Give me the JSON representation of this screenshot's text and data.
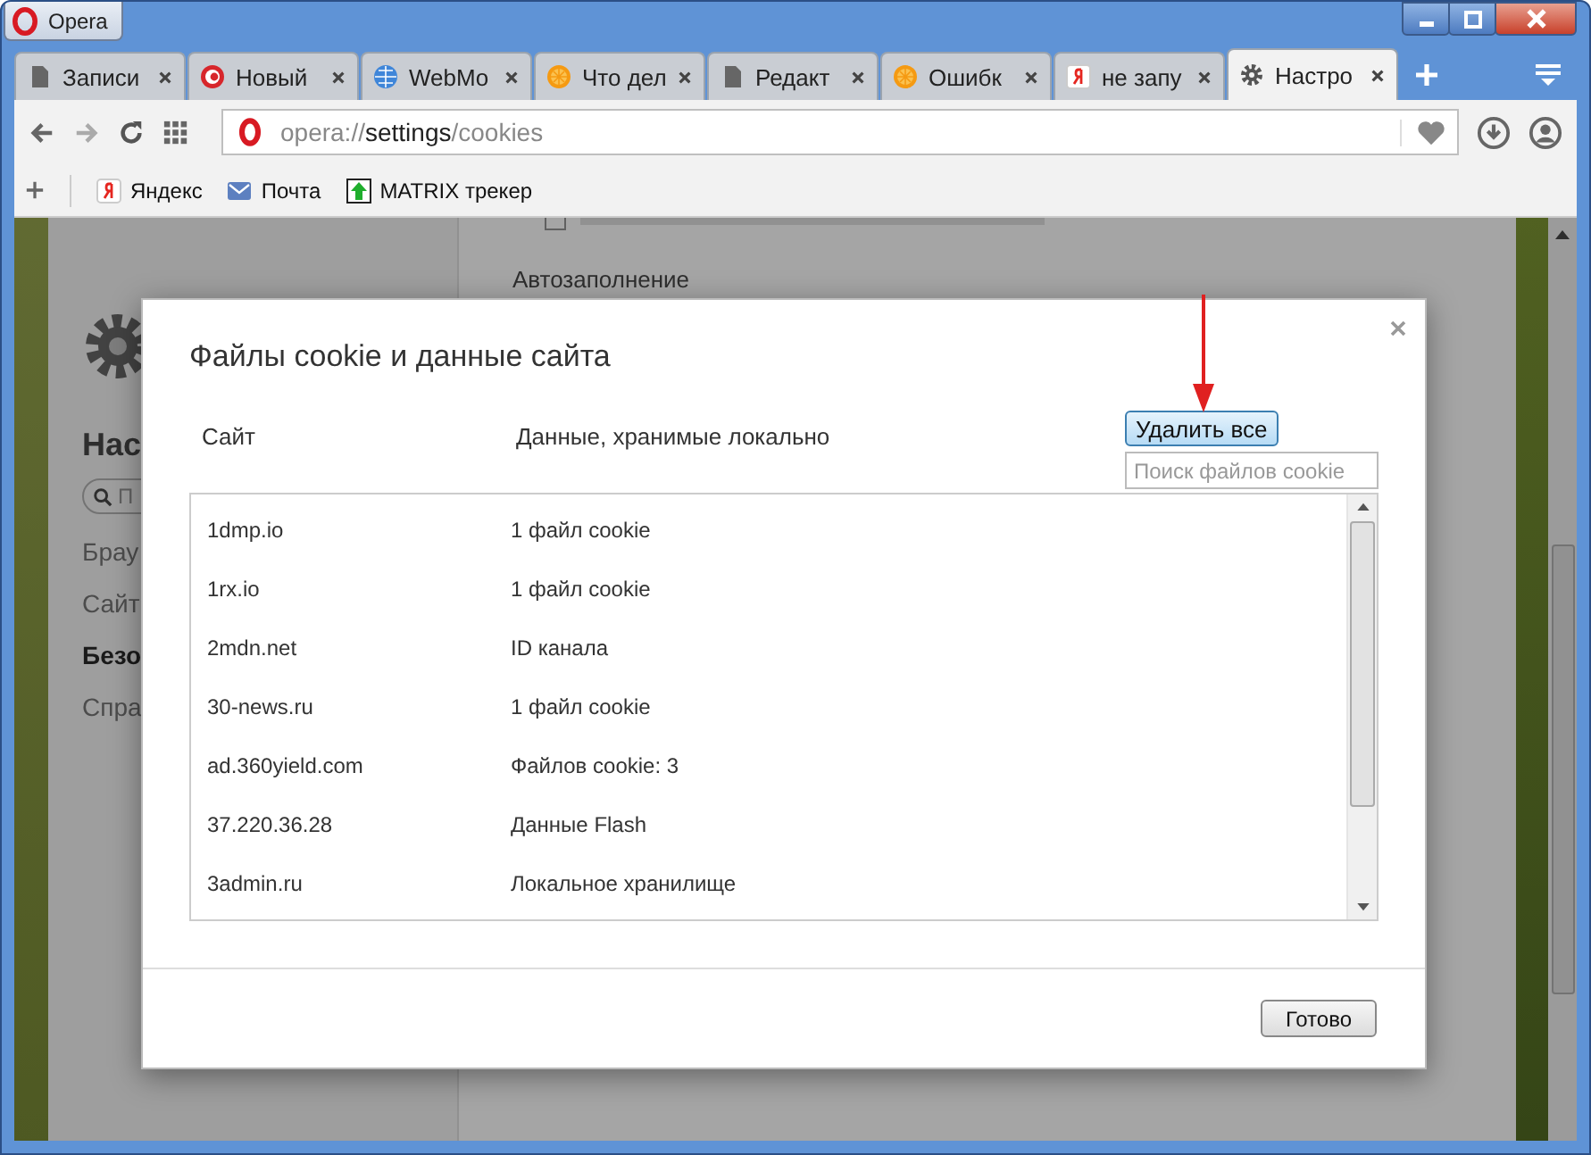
{
  "window": {
    "title": "Opera"
  },
  "tabs": [
    {
      "label": "Записи",
      "kind": "page",
      "selected": false
    },
    {
      "label": "Новый",
      "kind": "opera",
      "selected": false
    },
    {
      "label": "WebMo",
      "kind": "globe",
      "selected": false
    },
    {
      "label": "Что дел",
      "kind": "orange",
      "selected": false
    },
    {
      "label": "Редакт",
      "kind": "page",
      "selected": false
    },
    {
      "label": "Ошибк",
      "kind": "orange",
      "selected": false
    },
    {
      "label": "не запу",
      "kind": "yandex",
      "selected": false
    },
    {
      "label": "Настро",
      "kind": "gear",
      "selected": true
    }
  ],
  "address": {
    "scheme": "opera://",
    "host": "settings",
    "path": "/cookies"
  },
  "bookmarks": [
    {
      "label": "Яндекс",
      "kind": "yandex"
    },
    {
      "label": "Почта",
      "kind": "mail"
    },
    {
      "label": "MATRIX трекер",
      "kind": "arrow"
    }
  ],
  "sidebar": {
    "title": "Нас",
    "search_placeholder": "П",
    "items": [
      {
        "label": "Брау",
        "selected": false
      },
      {
        "label": "Сайт",
        "selected": false
      },
      {
        "label": "Безо",
        "selected": true
      },
      {
        "label": "Спра",
        "selected": false
      }
    ]
  },
  "settings": {
    "section": "Автозаполнение"
  },
  "dialog": {
    "title": "Файлы cookie и данные сайта",
    "columns": [
      "Сайт",
      "Данные, хранимые локально"
    ],
    "remove_all": "Удалить все",
    "search_placeholder": "Поиск файлов cookie",
    "done": "Готово",
    "rows": [
      {
        "site": "1dmp.io",
        "data": "1 файл cookie"
      },
      {
        "site": "1rx.io",
        "data": "1 файл cookie"
      },
      {
        "site": "2mdn.net",
        "data": "ID канала"
      },
      {
        "site": "30-news.ru",
        "data": "1 файл cookie"
      },
      {
        "site": "ad.360yield.com",
        "data": "Файлов cookie: 3"
      },
      {
        "site": "37.220.36.28",
        "data": "Данные Flash"
      },
      {
        "site": "3admin.ru",
        "data": "Локальное хранилище"
      }
    ]
  }
}
